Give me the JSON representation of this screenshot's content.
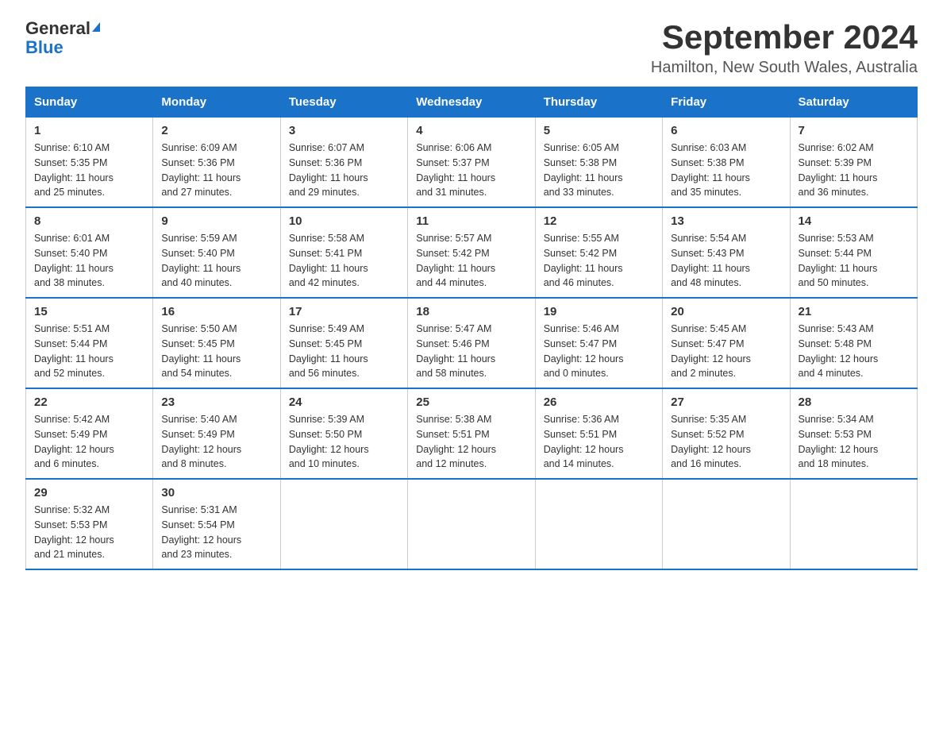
{
  "logo": {
    "general": "General",
    "blue": "Blue"
  },
  "title": "September 2024",
  "subtitle": "Hamilton, New South Wales, Australia",
  "days_of_week": [
    "Sunday",
    "Monday",
    "Tuesday",
    "Wednesday",
    "Thursday",
    "Friday",
    "Saturday"
  ],
  "weeks": [
    [
      {
        "day": "1",
        "sunrise": "Sunrise: 6:10 AM",
        "sunset": "Sunset: 5:35 PM",
        "daylight": "Daylight: 11 hours",
        "daylight2": "and 25 minutes."
      },
      {
        "day": "2",
        "sunrise": "Sunrise: 6:09 AM",
        "sunset": "Sunset: 5:36 PM",
        "daylight": "Daylight: 11 hours",
        "daylight2": "and 27 minutes."
      },
      {
        "day": "3",
        "sunrise": "Sunrise: 6:07 AM",
        "sunset": "Sunset: 5:36 PM",
        "daylight": "Daylight: 11 hours",
        "daylight2": "and 29 minutes."
      },
      {
        "day": "4",
        "sunrise": "Sunrise: 6:06 AM",
        "sunset": "Sunset: 5:37 PM",
        "daylight": "Daylight: 11 hours",
        "daylight2": "and 31 minutes."
      },
      {
        "day": "5",
        "sunrise": "Sunrise: 6:05 AM",
        "sunset": "Sunset: 5:38 PM",
        "daylight": "Daylight: 11 hours",
        "daylight2": "and 33 minutes."
      },
      {
        "day": "6",
        "sunrise": "Sunrise: 6:03 AM",
        "sunset": "Sunset: 5:38 PM",
        "daylight": "Daylight: 11 hours",
        "daylight2": "and 35 minutes."
      },
      {
        "day": "7",
        "sunrise": "Sunrise: 6:02 AM",
        "sunset": "Sunset: 5:39 PM",
        "daylight": "Daylight: 11 hours",
        "daylight2": "and 36 minutes."
      }
    ],
    [
      {
        "day": "8",
        "sunrise": "Sunrise: 6:01 AM",
        "sunset": "Sunset: 5:40 PM",
        "daylight": "Daylight: 11 hours",
        "daylight2": "and 38 minutes."
      },
      {
        "day": "9",
        "sunrise": "Sunrise: 5:59 AM",
        "sunset": "Sunset: 5:40 PM",
        "daylight": "Daylight: 11 hours",
        "daylight2": "and 40 minutes."
      },
      {
        "day": "10",
        "sunrise": "Sunrise: 5:58 AM",
        "sunset": "Sunset: 5:41 PM",
        "daylight": "Daylight: 11 hours",
        "daylight2": "and 42 minutes."
      },
      {
        "day": "11",
        "sunrise": "Sunrise: 5:57 AM",
        "sunset": "Sunset: 5:42 PM",
        "daylight": "Daylight: 11 hours",
        "daylight2": "and 44 minutes."
      },
      {
        "day": "12",
        "sunrise": "Sunrise: 5:55 AM",
        "sunset": "Sunset: 5:42 PM",
        "daylight": "Daylight: 11 hours",
        "daylight2": "and 46 minutes."
      },
      {
        "day": "13",
        "sunrise": "Sunrise: 5:54 AM",
        "sunset": "Sunset: 5:43 PM",
        "daylight": "Daylight: 11 hours",
        "daylight2": "and 48 minutes."
      },
      {
        "day": "14",
        "sunrise": "Sunrise: 5:53 AM",
        "sunset": "Sunset: 5:44 PM",
        "daylight": "Daylight: 11 hours",
        "daylight2": "and 50 minutes."
      }
    ],
    [
      {
        "day": "15",
        "sunrise": "Sunrise: 5:51 AM",
        "sunset": "Sunset: 5:44 PM",
        "daylight": "Daylight: 11 hours",
        "daylight2": "and 52 minutes."
      },
      {
        "day": "16",
        "sunrise": "Sunrise: 5:50 AM",
        "sunset": "Sunset: 5:45 PM",
        "daylight": "Daylight: 11 hours",
        "daylight2": "and 54 minutes."
      },
      {
        "day": "17",
        "sunrise": "Sunrise: 5:49 AM",
        "sunset": "Sunset: 5:45 PM",
        "daylight": "Daylight: 11 hours",
        "daylight2": "and 56 minutes."
      },
      {
        "day": "18",
        "sunrise": "Sunrise: 5:47 AM",
        "sunset": "Sunset: 5:46 PM",
        "daylight": "Daylight: 11 hours",
        "daylight2": "and 58 minutes."
      },
      {
        "day": "19",
        "sunrise": "Sunrise: 5:46 AM",
        "sunset": "Sunset: 5:47 PM",
        "daylight": "Daylight: 12 hours",
        "daylight2": "and 0 minutes."
      },
      {
        "day": "20",
        "sunrise": "Sunrise: 5:45 AM",
        "sunset": "Sunset: 5:47 PM",
        "daylight": "Daylight: 12 hours",
        "daylight2": "and 2 minutes."
      },
      {
        "day": "21",
        "sunrise": "Sunrise: 5:43 AM",
        "sunset": "Sunset: 5:48 PM",
        "daylight": "Daylight: 12 hours",
        "daylight2": "and 4 minutes."
      }
    ],
    [
      {
        "day": "22",
        "sunrise": "Sunrise: 5:42 AM",
        "sunset": "Sunset: 5:49 PM",
        "daylight": "Daylight: 12 hours",
        "daylight2": "and 6 minutes."
      },
      {
        "day": "23",
        "sunrise": "Sunrise: 5:40 AM",
        "sunset": "Sunset: 5:49 PM",
        "daylight": "Daylight: 12 hours",
        "daylight2": "and 8 minutes."
      },
      {
        "day": "24",
        "sunrise": "Sunrise: 5:39 AM",
        "sunset": "Sunset: 5:50 PM",
        "daylight": "Daylight: 12 hours",
        "daylight2": "and 10 minutes."
      },
      {
        "day": "25",
        "sunrise": "Sunrise: 5:38 AM",
        "sunset": "Sunset: 5:51 PM",
        "daylight": "Daylight: 12 hours",
        "daylight2": "and 12 minutes."
      },
      {
        "day": "26",
        "sunrise": "Sunrise: 5:36 AM",
        "sunset": "Sunset: 5:51 PM",
        "daylight": "Daylight: 12 hours",
        "daylight2": "and 14 minutes."
      },
      {
        "day": "27",
        "sunrise": "Sunrise: 5:35 AM",
        "sunset": "Sunset: 5:52 PM",
        "daylight": "Daylight: 12 hours",
        "daylight2": "and 16 minutes."
      },
      {
        "day": "28",
        "sunrise": "Sunrise: 5:34 AM",
        "sunset": "Sunset: 5:53 PM",
        "daylight": "Daylight: 12 hours",
        "daylight2": "and 18 minutes."
      }
    ],
    [
      {
        "day": "29",
        "sunrise": "Sunrise: 5:32 AM",
        "sunset": "Sunset: 5:53 PM",
        "daylight": "Daylight: 12 hours",
        "daylight2": "and 21 minutes."
      },
      {
        "day": "30",
        "sunrise": "Sunrise: 5:31 AM",
        "sunset": "Sunset: 5:54 PM",
        "daylight": "Daylight: 12 hours",
        "daylight2": "and 23 minutes."
      },
      null,
      null,
      null,
      null,
      null
    ]
  ]
}
